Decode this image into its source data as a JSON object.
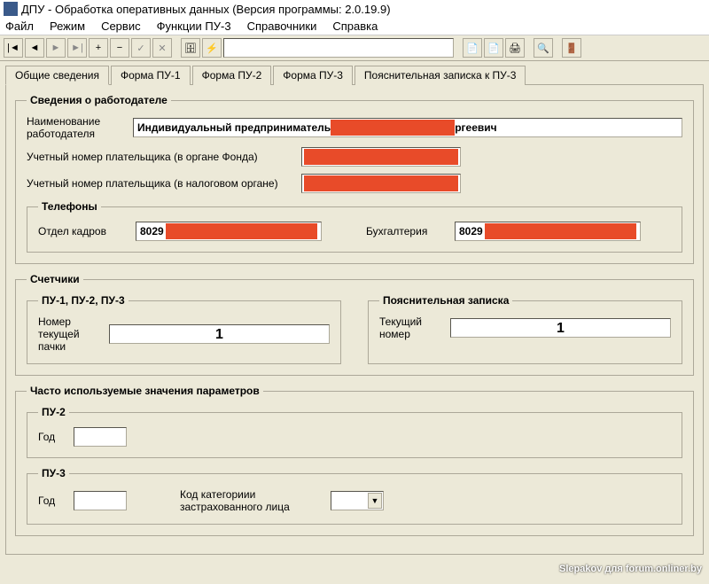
{
  "title": "ДПУ - Обработка оперативных данных (Версия программы: 2.0.19.9)",
  "menus": {
    "file": "Файл",
    "mode": "Режим",
    "service": "Сервис",
    "funcs": "Функции ПУ-3",
    "refs": "Справочники",
    "help": "Справка"
  },
  "toolbar": {
    "first": "|◄",
    "prev": "◄",
    "next": "►",
    "last": "►|",
    "plus": "+",
    "minus": "−",
    "check": "✓",
    "cancel": "✕",
    "db": "🗄",
    "light": "⚡",
    "doc1": "📄",
    "doc2": "📄",
    "print": "🖨",
    "search": "🔍",
    "exit": "🚪"
  },
  "tabs": {
    "t0": "Общие сведения",
    "t1": "Форма ПУ-1",
    "t2": "Форма ПУ-2",
    "t3": "Форма ПУ-3",
    "t4": "Пояснительная записка к ПУ-3"
  },
  "employer": {
    "legend": "Сведения о работодателе",
    "name_label": "Наименование работодателя",
    "name_prefix": "Индивидуальный предприниматель ",
    "name_suffix": "ргеевич",
    "acctFund_label": "Учетный номер плательщика (в органе Фонда)",
    "acctTax_label": "Учетный номер плательщика (в налоговом органе)",
    "phones": {
      "legend": "Телефоны",
      "hr_label": "Отдел кадров",
      "hr_value": "8029",
      "acc_label": "Бухгалтерия",
      "acc_value": "8029"
    }
  },
  "counters": {
    "legend": "Счетчики",
    "pu": {
      "legend": "ПУ-1, ПУ-2, ПУ-3",
      "label": "Номер текущей пачки",
      "value": "1"
    },
    "note": {
      "legend": "Пояснительная записка",
      "label": "Текущий номер",
      "value": "1"
    }
  },
  "freq": {
    "legend": "Часто используемые значения параметров",
    "pu2": {
      "legend": "ПУ-2",
      "year_label": "Год",
      "year_value": ""
    },
    "pu3": {
      "legend": "ПУ-3",
      "year_label": "Год",
      "year_value": "",
      "cat_label": "Код категориии застрахованного лица",
      "cat_value": ""
    }
  },
  "watermark": "Slepakov для forum.onliner.by"
}
